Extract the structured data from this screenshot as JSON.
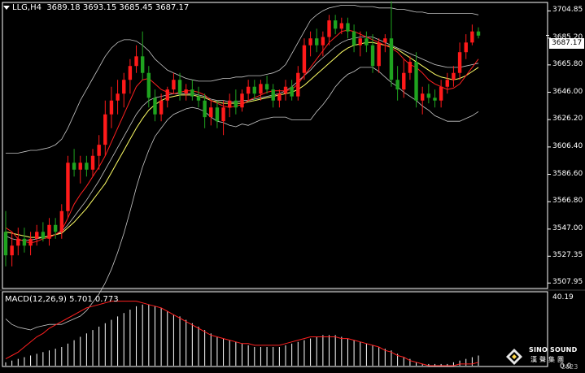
{
  "header": {
    "symbol": "LLG,H4",
    "ohlc": "3689.18 3693.15 3685.45 3687.17"
  },
  "macd": {
    "label": "MACD(12,26,9) 5.701 0.773",
    "top_value": "40.19",
    "bottom_value": "0.0"
  },
  "logo": {
    "title": "SINO SOUND",
    "subtitle": "漢聲集團"
  },
  "date_label": "2023",
  "colors": {
    "background": "#000000",
    "bull": "#ff1a1a",
    "bear": "#1fa31f",
    "bollinger": "#c8c8c8",
    "ma_fast": "#ff2020",
    "ma_slow": "#ffff66",
    "macd_hist": "#ffffff",
    "macd_signal": "#ff2020",
    "grid": "#ffffff"
  },
  "chart_data": {
    "type": "candlestick",
    "title": "LLG,H4",
    "current_price": "3687.17",
    "y_ticks": [
      "3704.85",
      "3685.20",
      "3665.80",
      "3646.00",
      "3626.20",
      "3606.40",
      "3586.60",
      "3566.80",
      "3547.00",
      "3527.35",
      "3507.95"
    ],
    "ylim": [
      3504,
      3711
    ],
    "candles": [
      [
        3545,
        3560,
        3520,
        3528
      ],
      [
        3528,
        3545,
        3520,
        3535
      ],
      [
        3535,
        3548,
        3528,
        3540
      ],
      [
        3540,
        3548,
        3530,
        3535
      ],
      [
        3535,
        3545,
        3528,
        3540
      ],
      [
        3540,
        3550,
        3535,
        3545
      ],
      [
        3545,
        3552,
        3538,
        3540
      ],
      [
        3540,
        3555,
        3535,
        3550
      ],
      [
        3550,
        3555,
        3540,
        3545
      ],
      [
        3545,
        3565,
        3540,
        3560
      ],
      [
        3560,
        3600,
        3555,
        3595
      ],
      [
        3595,
        3605,
        3585,
        3590
      ],
      [
        3590,
        3600,
        3580,
        3595
      ],
      [
        3595,
        3600,
        3585,
        3590
      ],
      [
        3590,
        3605,
        3585,
        3600
      ],
      [
        3600,
        3615,
        3590,
        3608
      ],
      [
        3608,
        3640,
        3600,
        3630
      ],
      [
        3630,
        3650,
        3620,
        3640
      ],
      [
        3640,
        3655,
        3630,
        3645
      ],
      [
        3645,
        3660,
        3635,
        3655
      ],
      [
        3655,
        3670,
        3645,
        3665
      ],
      [
        3665,
        3680,
        3660,
        3672
      ],
      [
        3672,
        3690,
        3655,
        3660
      ],
      [
        3660,
        3665,
        3635,
        3642
      ],
      [
        3642,
        3648,
        3625,
        3630
      ],
      [
        3630,
        3645,
        3625,
        3640
      ],
      [
        3640,
        3650,
        3635,
        3648
      ],
      [
        3648,
        3660,
        3645,
        3655
      ],
      [
        3655,
        3660,
        3640,
        3645
      ],
      [
        3645,
        3652,
        3640,
        3648
      ],
      [
        3648,
        3655,
        3640,
        3643
      ],
      [
        3643,
        3650,
        3635,
        3640
      ],
      [
        3640,
        3645,
        3620,
        3628
      ],
      [
        3628,
        3640,
        3622,
        3635
      ],
      [
        3635,
        3640,
        3620,
        3625
      ],
      [
        3625,
        3640,
        3615,
        3635
      ],
      [
        3635,
        3645,
        3628,
        3640
      ],
      [
        3640,
        3648,
        3630,
        3635
      ],
      [
        3635,
        3648,
        3632,
        3645
      ],
      [
        3645,
        3655,
        3640,
        3650
      ],
      [
        3650,
        3655,
        3640,
        3645
      ],
      [
        3645,
        3655,
        3640,
        3652
      ],
      [
        3652,
        3658,
        3645,
        3648
      ],
      [
        3648,
        3652,
        3635,
        3640
      ],
      [
        3640,
        3648,
        3635,
        3645
      ],
      [
        3645,
        3655,
        3640,
        3650
      ],
      [
        3650,
        3655,
        3640,
        3643
      ],
      [
        3643,
        3665,
        3640,
        3660
      ],
      [
        3660,
        3685,
        3655,
        3680
      ],
      [
        3680,
        3690,
        3672,
        3685
      ],
      [
        3685,
        3692,
        3675,
        3680
      ],
      [
        3680,
        3690,
        3672,
        3686
      ],
      [
        3686,
        3702,
        3680,
        3698
      ],
      [
        3698,
        3702,
        3688,
        3692
      ],
      [
        3692,
        3700,
        3688,
        3696
      ],
      [
        3696,
        3700,
        3685,
        3690
      ],
      [
        3690,
        3695,
        3675,
        3680
      ],
      [
        3680,
        3690,
        3672,
        3685
      ],
      [
        3685,
        3690,
        3675,
        3680
      ],
      [
        3680,
        3688,
        3660,
        3665
      ],
      [
        3665,
        3685,
        3660,
        3682
      ],
      [
        3682,
        3688,
        3675,
        3685
      ],
      [
        3685,
        3712,
        3650,
        3655
      ],
      [
        3655,
        3665,
        3640,
        3648
      ],
      [
        3648,
        3670,
        3642,
        3660
      ],
      [
        3660,
        3672,
        3655,
        3668
      ],
      [
        3668,
        3675,
        3635,
        3640
      ],
      [
        3640,
        3650,
        3630,
        3645
      ],
      [
        3645,
        3652,
        3638,
        3642
      ],
      [
        3642,
        3648,
        3635,
        3640
      ],
      [
        3640,
        3655,
        3635,
        3650
      ],
      [
        3650,
        3660,
        3645,
        3655
      ],
      [
        3655,
        3665,
        3650,
        3660
      ],
      [
        3660,
        3682,
        3655,
        3675
      ],
      [
        3675,
        3688,
        3670,
        3682
      ],
      [
        3682,
        3695,
        3680,
        3690
      ],
      [
        3690,
        3693,
        3685,
        3687
      ]
    ],
    "bollinger_upper": [
      3602,
      3602,
      3602,
      3603,
      3604,
      3604,
      3605,
      3606,
      3608,
      3612,
      3620,
      3630,
      3640,
      3648,
      3656,
      3664,
      3672,
      3678,
      3682,
      3684,
      3684,
      3683,
      3680,
      3676,
      3670,
      3666,
      3662,
      3660,
      3658,
      3656,
      3655,
      3654,
      3654,
      3654,
      3655,
      3656,
      3656,
      3657,
      3657,
      3658,
      3658,
      3658,
      3659,
      3660,
      3662,
      3666,
      3674,
      3682,
      3690,
      3698,
      3702,
      3705,
      3707,
      3708,
      3709,
      3709,
      3709,
      3708,
      3708,
      3708,
      3707,
      3707,
      3707,
      3706,
      3706,
      3705,
      3704,
      3704,
      3703,
      3703,
      3703,
      3703,
      3703,
      3703,
      3703,
      3703,
      3702
    ],
    "bollinger_mid": [
      3542,
      3540,
      3539,
      3539,
      3539,
      3540,
      3541,
      3542,
      3543,
      3545,
      3550,
      3556,
      3562,
      3568,
      3575,
      3582,
      3590,
      3598,
      3606,
      3614,
      3622,
      3630,
      3636,
      3640,
      3642,
      3643,
      3644,
      3645,
      3645,
      3645,
      3645,
      3644,
      3643,
      3641,
      3640,
      3640,
      3639,
      3639,
      3640,
      3640,
      3641,
      3642,
      3643,
      3644,
      3645,
      3647,
      3650,
      3654,
      3658,
      3662,
      3667,
      3671,
      3675,
      3679,
      3682,
      3684,
      3685,
      3686,
      3686,
      3686,
      3684,
      3682,
      3680,
      3678,
      3676,
      3674,
      3672,
      3670,
      3668,
      3666,
      3665,
      3664,
      3664,
      3664,
      3665,
      3666,
      3667
    ],
    "bollinger_lower": [
      3482,
      3478,
      3476,
      3475,
      3474,
      3476,
      3477,
      3478,
      3478,
      3478,
      3480,
      3482,
      3484,
      3488,
      3494,
      3500,
      3508,
      3518,
      3530,
      3544,
      3560,
      3577,
      3592,
      3604,
      3614,
      3620,
      3626,
      3630,
      3632,
      3634,
      3635,
      3634,
      3632,
      3628,
      3625,
      3624,
      3622,
      3621,
      3623,
      3622,
      3624,
      3626,
      3627,
      3628,
      3628,
      3628,
      3626,
      3626,
      3626,
      3626,
      3632,
      3637,
      3643,
      3650,
      3655,
      3659,
      3661,
      3664,
      3664,
      3664,
      3661,
      3657,
      3653,
      3650,
      3646,
      3643,
      3640,
      3636,
      3633,
      3629,
      3627,
      3625,
      3625,
      3625,
      3627,
      3629,
      3632
    ],
    "ma_fast": [
      3548,
      3545,
      3540,
      3538,
      3537,
      3538,
      3540,
      3541,
      3543,
      3546,
      3555,
      3565,
      3572,
      3578,
      3585,
      3592,
      3600,
      3610,
      3620,
      3630,
      3640,
      3650,
      3655,
      3656,
      3652,
      3648,
      3646,
      3645,
      3646,
      3647,
      3647,
      3646,
      3644,
      3640,
      3638,
      3636,
      3635,
      3636,
      3637,
      3640,
      3642,
      3644,
      3646,
      3647,
      3647,
      3647,
      3648,
      3652,
      3658,
      3664,
      3670,
      3676,
      3682,
      3686,
      3690,
      3691,
      3690,
      3688,
      3686,
      3684,
      3682,
      3680,
      3678,
      3675,
      3670,
      3666,
      3664,
      3660,
      3655,
      3652,
      3650,
      3648,
      3649,
      3652,
      3658,
      3664,
      3670
    ],
    "ma_slow": [
      3545,
      3544,
      3543,
      3542,
      3541,
      3541,
      3541,
      3542,
      3543,
      3544,
      3548,
      3552,
      3557,
      3562,
      3568,
      3574,
      3580,
      3588,
      3596,
      3604,
      3612,
      3620,
      3627,
      3633,
      3637,
      3640,
      3642,
      3643,
      3644,
      3644,
      3644,
      3643,
      3642,
      3640,
      3639,
      3638,
      3638,
      3638,
      3638,
      3639,
      3640,
      3641,
      3642,
      3643,
      3644,
      3645,
      3646,
      3648,
      3651,
      3655,
      3659,
      3663,
      3667,
      3671,
      3675,
      3678,
      3680,
      3681,
      3682,
      3682,
      3681,
      3680,
      3679,
      3677,
      3674,
      3671,
      3668,
      3665,
      3662,
      3659,
      3657,
      3656,
      3655,
      3656,
      3658,
      3661,
      3664
    ],
    "macd_hist": [
      2,
      3,
      4,
      5,
      6,
      7,
      8,
      9,
      10,
      11,
      13,
      15,
      17,
      19,
      21,
      23,
      25,
      27,
      29,
      31,
      33,
      35,
      36,
      36,
      35,
      34,
      32,
      30,
      29,
      27,
      25,
      23,
      21,
      19,
      17,
      16,
      15,
      14,
      13,
      12,
      11,
      11,
      11,
      11,
      11,
      12,
      13,
      14,
      15,
      16,
      17,
      18,
      18,
      18,
      17,
      16,
      15,
      14,
      13,
      12,
      11,
      10,
      9,
      7,
      5,
      4,
      2,
      1,
      1,
      1,
      1,
      1,
      2,
      3,
      4,
      5,
      6
    ],
    "macd_signal": [
      4,
      6,
      8,
      11,
      14,
      17,
      19,
      22,
      24,
      26,
      28,
      30,
      32,
      34,
      35,
      36,
      37,
      38,
      38,
      38,
      38,
      38,
      37,
      36,
      35,
      34,
      32,
      30,
      28,
      26,
      24,
      22,
      20,
      18,
      17,
      16,
      15,
      14,
      13,
      13,
      12,
      12,
      12,
      12,
      12,
      13,
      14,
      15,
      16,
      17,
      17,
      17,
      17,
      17,
      16,
      16,
      15,
      14,
      13,
      12,
      11,
      9,
      8,
      6,
      5,
      3,
      2,
      1,
      0,
      0,
      0,
      0,
      0,
      1,
      1,
      1,
      2
    ],
    "macd_ylim": [
      0,
      40.19
    ]
  }
}
